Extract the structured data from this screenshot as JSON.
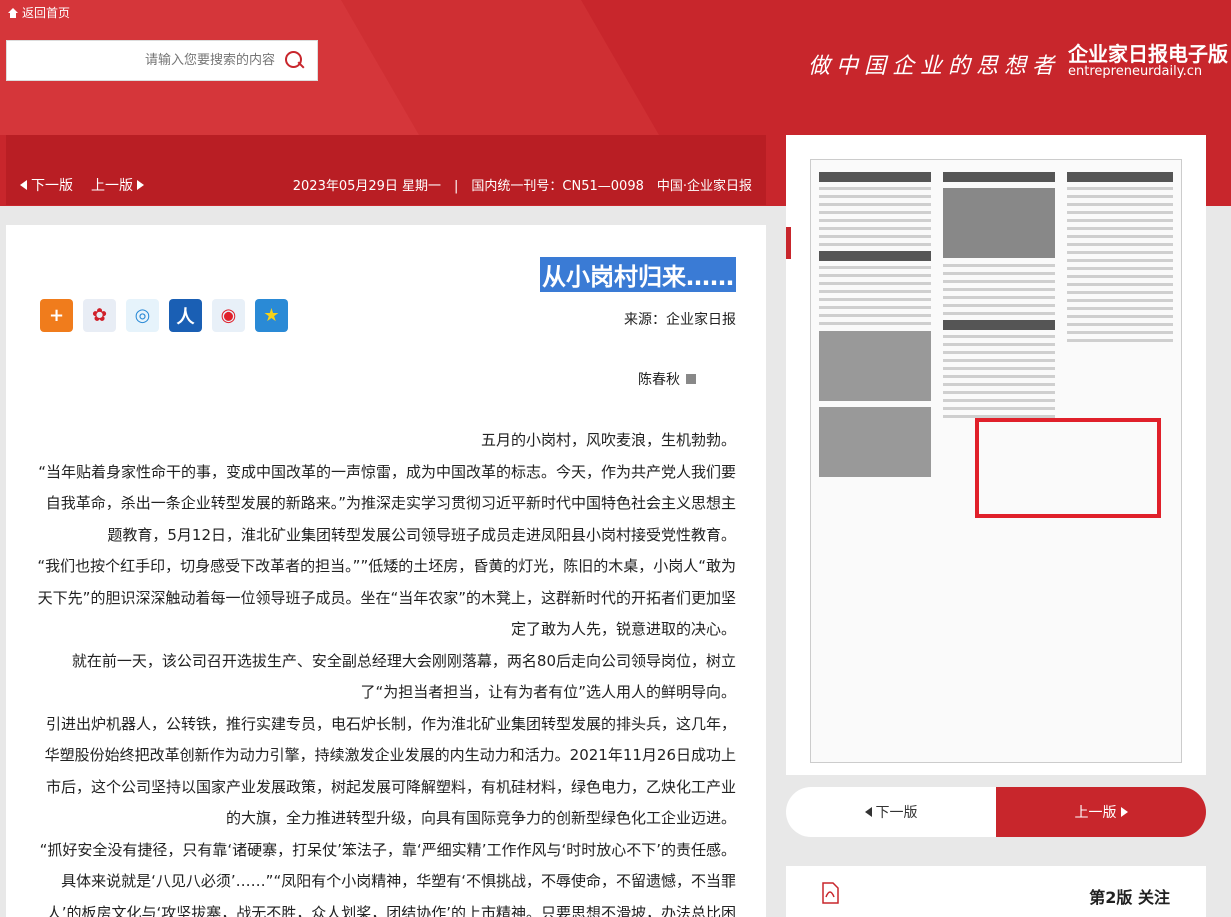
{
  "topbar": {
    "home_label": "返回首页"
  },
  "search": {
    "placeholder": "请输入您要搜索的内容"
  },
  "header": {
    "slogan": "做中国企业的思想者",
    "brand_title": "企业家日报电子版",
    "brand_sub": "entrepreneurdaily.cn"
  },
  "infobar": {
    "prev_label": "上一版",
    "next_label": "下一版",
    "meta": "2023年05月29日 星期一　|　国内统一刊号：CN51—0098　中国·企业家日报"
  },
  "article": {
    "title": "从小岗村归来……",
    "source": "来源：企业家日报",
    "author": "陈春秋",
    "paragraphs": [
      "五月的小岗村，风吹麦浪，生机勃勃。",
      "“当年贴着身家性命干的事，变成中国改革的一声惊雷，成为中国改革的标志。今天，作为共产党人我们要自我革命，杀出一条企业转型发展的新路来。”为推深走实学习贯彻习近平新时代中国特色社会主义思想主题教育，5月12日，淮北矿业集团转型发展公司领导班子成员走进凤阳县小岗村接受党性教育。",
      "“我们也按个红手印，切身感受下改革者的担当。””低矮的土坯房，昏黄的灯光，陈旧的木桌，小岗人“敢为天下先”的胆识深深触动着每一位领导班子成员。坐在“当年农家”的木凳上，这群新时代的开拓者们更加坚定了敢为人先，锐意进取的决心。",
      "就在前一天，该公司召开选拔生产、安全副总经理大会刚刚落幕，两名80后走向公司领导岗位，树立了“为担当者担当，让有为者有位”选人用人的鲜明导向。",
      "引进出炉机器人，公转铁，推行实建专员，电石炉长制，作为淮北矿业集团转型发展的排头兵，这几年，华塑股份始终把改革创新作为动力引擎，持续激发企业发展的内生动力和活力。2021年11月26日成功上市后，这个公司坚持以国家产业发展政策，树起发展可降解塑料，有机硅材料，绿色电力，乙炔化工产业的大旗，全力推进转型升级，向具有国际竞争力的创新型绿色化工企业迈进。",
      "“抓好安全没有捷径，只有靠‘诸硬寨，打呆仗’笨法子，靠‘严细实精’工作作风与‘时时放心不下’的责任感。具体来说就是‘八见八必须’……”“凤阳有个小岗精神，华塑有‘不惧挑战，不辱使命，不留遗憾，不当罪人’的板房文化与‘攻坚拔寨，战无不胜，众人划桨，团结协作’的上市精神。只要思想不滑坡，办法总比困难"
    ]
  },
  "share_icons": [
    "more-share-icon",
    "renren-icon",
    "qzone-icon",
    "people-icon",
    "weibo-icon",
    "favorite-star-icon"
  ],
  "pager": {
    "prev_label": "上一版",
    "next_label": "下一版"
  },
  "current_page": {
    "label": "第2版 关注"
  },
  "colors": {
    "brand_red": "#c8262c",
    "dark_red": "#b91e24",
    "highlight_red": "#e0202a",
    "title_highlight": "#3a7bd5"
  }
}
